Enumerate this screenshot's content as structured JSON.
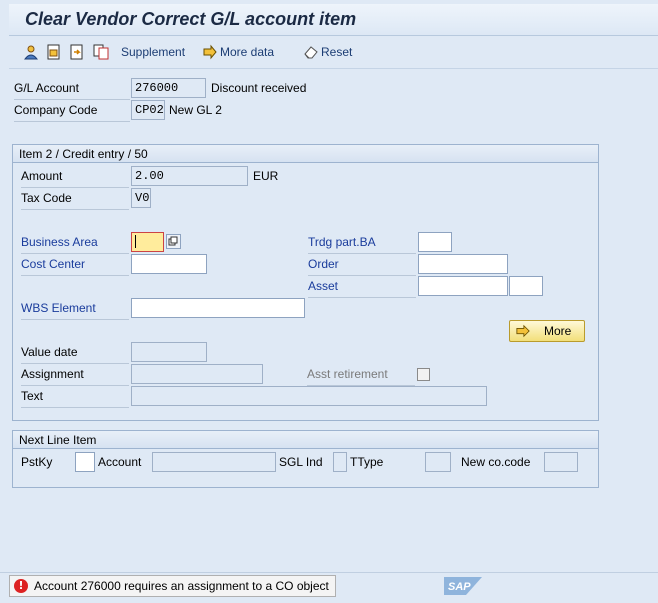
{
  "title": "Clear Vendor Correct G/L account item",
  "toolbar": {
    "supplement_label": "Supplement",
    "more_data_label": "More data",
    "reset_label": "Reset"
  },
  "header": {
    "gl_account_label": "G/L Account",
    "gl_account_value": "276000",
    "gl_account_desc": "Discount received",
    "company_code_label": "Company Code",
    "company_code_value": "CP02",
    "company_code_desc": "New GL 2"
  },
  "item": {
    "group_title": "Item 2 / Credit entry / 50",
    "amount_label": "Amount",
    "amount_value": "2.00",
    "currency": "EUR",
    "tax_code_label": "Tax Code",
    "tax_code_value": "V0",
    "business_area_label": "Business Area",
    "business_area_value": "",
    "trdg_part_ba_label": "Trdg part.BA",
    "cost_center_label": "Cost Center",
    "order_label": "Order",
    "asset_label": "Asset",
    "wbs_element_label": "WBS Element",
    "more_button_label": "More",
    "value_date_label": "Value date",
    "assignment_label": "Assignment",
    "asst_retirement_label": "Asst retirement",
    "text_label": "Text"
  },
  "next_line": {
    "group_title": "Next Line Item",
    "pstky_label": "PstKy",
    "account_label": "Account",
    "sgl_ind_label": "SGL Ind",
    "ttype_label": "TType",
    "new_co_code_label": "New co.code"
  },
  "status": {
    "type": "error",
    "message": "Account 276000 requires an assignment to a CO object"
  },
  "branding": {
    "logo": "SAP"
  },
  "colors": {
    "background": "#dfe9f5",
    "label_blue": "#1a3c9c",
    "focus_field": "#ffec9c",
    "error_red": "#d22"
  }
}
